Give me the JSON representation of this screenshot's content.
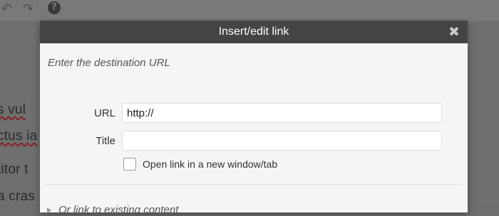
{
  "background": {
    "toolbar": {
      "undo_icon": "undo-arrow",
      "redo_icon": "redo-arrow",
      "help_icon": "?"
    },
    "lines": [
      "s vul",
      "ctus ia",
      "titor t",
      "a cras"
    ]
  },
  "dialog": {
    "title": "Insert/edit link",
    "close_glyph": "✖",
    "instructions": "Enter the destination URL",
    "url_label": "URL",
    "url_value": "http://",
    "title_label": "Title",
    "title_value": "",
    "new_window_label": "Open link in a new window/tab",
    "existing_content_toggle": "Or link to existing content"
  },
  "colors": {
    "header_bg": "#444444",
    "body_bg": "#f5f5f5",
    "overlay": "#6e6e6e"
  }
}
